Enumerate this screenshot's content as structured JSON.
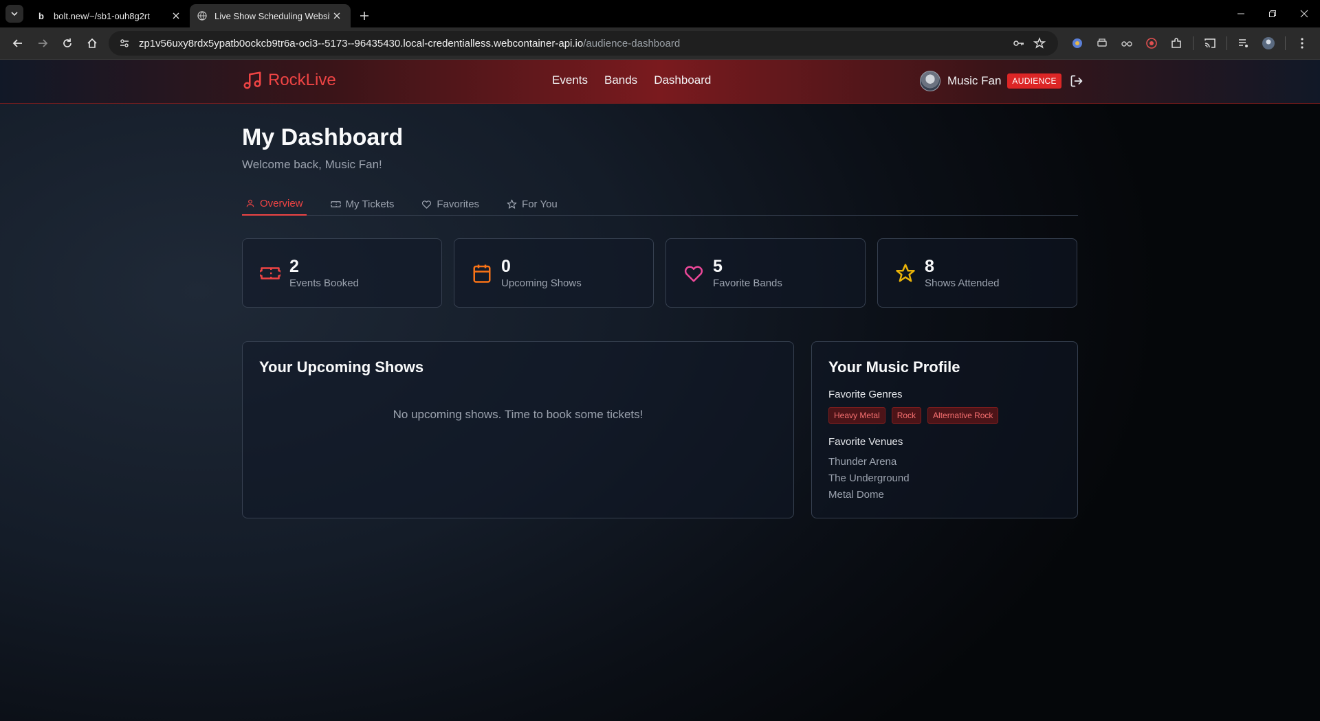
{
  "browser": {
    "tabs": [
      {
        "title": "bolt.new/~/sb1-ouh8g2rt",
        "active": false
      },
      {
        "title": "Live Show Scheduling Websit",
        "active": true
      }
    ],
    "url_host": "zp1v56uxy8rdx5ypatb0ockcb9tr6a-oci3--5173--96435430.local-credentialless.webcontainer-api.io",
    "url_path": "/audience-dashboard"
  },
  "site": {
    "logo": "RockLive",
    "nav": [
      "Events",
      "Bands",
      "Dashboard"
    ],
    "user_name": "Music Fan",
    "role_badge": "AUDIENCE"
  },
  "dashboard": {
    "title": "My Dashboard",
    "welcome": "Welcome back, Music Fan!",
    "tabs": [
      {
        "label": "Overview",
        "icon": "user-icon",
        "active": true
      },
      {
        "label": "My Tickets",
        "icon": "ticket-icon",
        "active": false
      },
      {
        "label": "Favorites",
        "icon": "heart-icon",
        "active": false
      },
      {
        "label": "For You",
        "icon": "star-icon",
        "active": false
      }
    ],
    "stats": [
      {
        "value": "2",
        "label": "Events Booked",
        "icon": "ticket-icon",
        "color": "#ef4444"
      },
      {
        "value": "0",
        "label": "Upcoming Shows",
        "icon": "calendar-icon",
        "color": "#f97316"
      },
      {
        "value": "5",
        "label": "Favorite Bands",
        "icon": "heart-icon",
        "color": "#ec4899"
      },
      {
        "value": "8",
        "label": "Shows Attended",
        "icon": "star-icon",
        "color": "#eab308"
      }
    ],
    "upcoming": {
      "title": "Your Upcoming Shows",
      "empty": "No upcoming shows. Time to book some tickets!"
    },
    "profile": {
      "title": "Your Music Profile",
      "genres_label": "Favorite Genres",
      "genres": [
        "Heavy Metal",
        "Rock",
        "Alternative Rock"
      ],
      "venues_label": "Favorite Venues",
      "venues": [
        "Thunder Arena",
        "The Underground",
        "Metal Dome"
      ]
    }
  },
  "colors": {
    "accent": "#ef4444",
    "badge": "#dc2626",
    "bg": "#141c28"
  }
}
